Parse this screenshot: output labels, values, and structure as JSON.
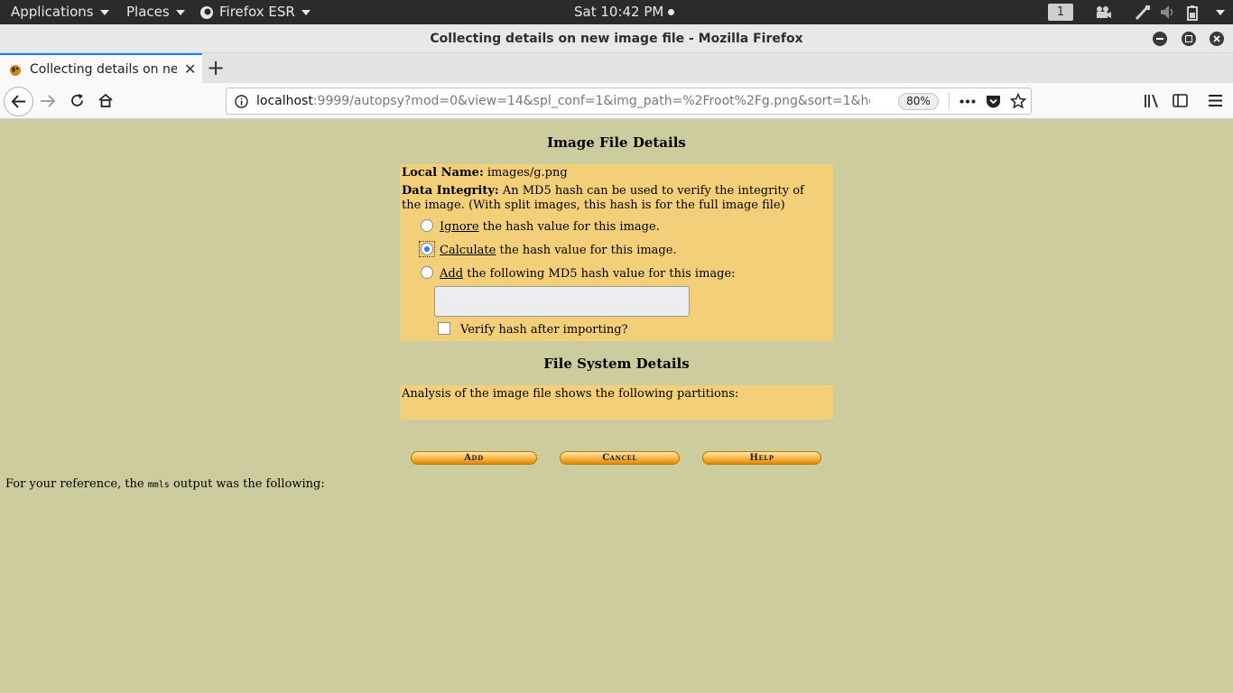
{
  "topbar": {
    "applications": "Applications",
    "places": "Places",
    "browser_app": "Firefox ESR",
    "clock": "Sat 10:42 PM",
    "workspace": "1"
  },
  "window": {
    "title": "Collecting details on new image file - Mozilla Firefox"
  },
  "tabs": [
    {
      "label": "Collecting details on new image file"
    }
  ],
  "navbar": {
    "url_host": "localhost",
    "url_rest": ":9999/autopsy?mod=0&view=14&spl_conf=1&img_path=%2Froot%2Fg.png&sort=1&host=h",
    "zoom": "80%"
  },
  "page": {
    "image_details_heading": "Image File Details",
    "local_name_label": "Local Name:",
    "local_name_value": "images/g.png",
    "data_integrity_label": "Data Integrity:",
    "data_integrity_text": "An MD5 hash can be used to verify the integrity of the image. (With split images, this hash is for the full image file)",
    "options": [
      {
        "keyword": "Ignore",
        "rest": "the hash value for this image.",
        "checked": false
      },
      {
        "keyword": "Calculate",
        "rest": "the hash value for this image.",
        "checked": true
      },
      {
        "keyword": "Add",
        "rest": "the following MD5 hash value for this image:",
        "checked": false
      }
    ],
    "md5_value": "",
    "verify_label": "Verify hash after importing?",
    "verify_checked": false,
    "fs_heading": "File System Details",
    "fs_text": "Analysis of the image file shows the following partitions:",
    "buttons": {
      "add": "Add",
      "cancel": "Cancel",
      "help": "Help"
    },
    "reference_prefix": "For your reference, the ",
    "reference_cmd": "mmls",
    "reference_suffix": " output was the following:"
  }
}
